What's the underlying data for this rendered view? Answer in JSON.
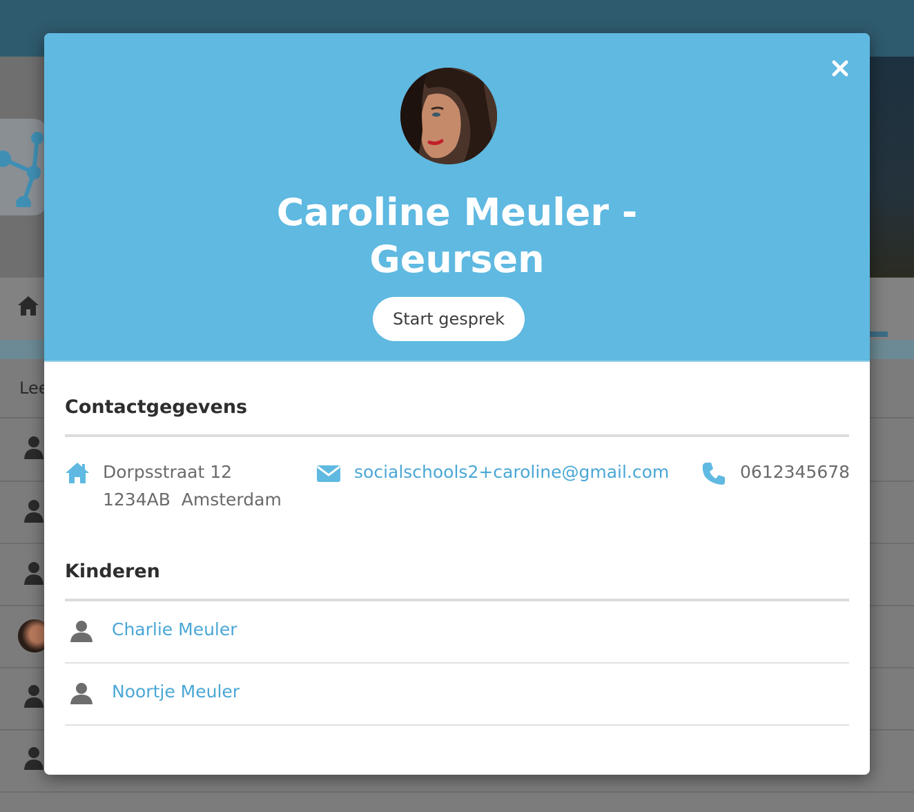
{
  "background": {
    "list_header_fragment": "Lee"
  },
  "profile": {
    "name_line1": "Caroline Meuler -",
    "name_line2": "Geursen",
    "start_button_label": "Start gesprek",
    "avatar_icon": "user-photo"
  },
  "contact": {
    "title": "Contactgegevens",
    "address_line1": "Dorpsstraat 12",
    "address_line2": "1234AB  Amsterdam",
    "email": "socialschools2+caroline@gmail.com",
    "phone": "0612345678",
    "icons": [
      "home-icon",
      "envelope-icon",
      "phone-icon"
    ]
  },
  "children": {
    "title": "Kinderen",
    "items": [
      {
        "name": "Charlie Meuler",
        "icon": "user-icon"
      },
      {
        "name": "Noortje Meuler",
        "icon": "user-icon"
      }
    ]
  },
  "colors": {
    "header_blue": "#5fb9e1",
    "link_blue": "#4aa7d6",
    "topbar": "#2f5b6e"
  }
}
